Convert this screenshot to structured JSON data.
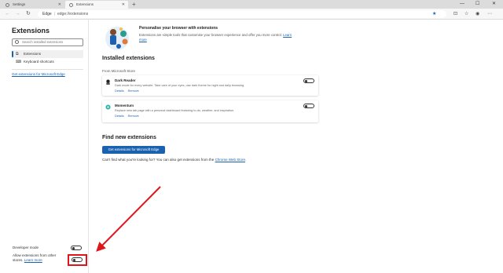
{
  "tabs": [
    {
      "label": "Settings",
      "active": false
    },
    {
      "label": "Extensions",
      "active": true
    }
  ],
  "toolbar": {
    "browser_label": "Edge",
    "url": "edge://extensions"
  },
  "sidebar": {
    "title": "Extensions",
    "search_placeholder": "Search installed extensions",
    "items": [
      {
        "label": "Extensions",
        "icon": "extensions-icon",
        "selected": true
      },
      {
        "label": "Keyboard shortcuts",
        "icon": "keyboard-icon",
        "selected": false
      }
    ],
    "store_link": "Get extensions for Microsoft Edge",
    "developer_mode_label": "Developer mode",
    "other_stores_label": "Allow extensions from other stores.",
    "other_stores_link": "Learn more"
  },
  "hero": {
    "title": "Personalise your browser with extensions",
    "description": "Extensions are simple tools that customise your browser experience and offer you more control.",
    "learn_more": "Learn more"
  },
  "installed": {
    "heading": "Installed extensions",
    "source": "From Microsoft Store",
    "extensions": [
      {
        "name": "Dark Reader",
        "description": "Dark mode for every website. Take care of your eyes, use dark theme for night and daily browsing.",
        "details": "Details",
        "remove": "Remove",
        "enabled": false
      },
      {
        "name": "Momentum",
        "description": "Replace new tab page with a personal dashboard featuring to-do, weather, and inspiration.",
        "details": "Details",
        "remove": "Remove",
        "enabled": false
      }
    ]
  },
  "find_new": {
    "heading": "Find new extensions",
    "button": "Get extensions for Microsoft Edge",
    "text": "Can't find what you're looking for? You can also get extensions from the",
    "link": "Chrome Web Store",
    "suffix": "."
  },
  "colors": {
    "accent": "#1a62b0",
    "annotation": "#e0151b"
  }
}
